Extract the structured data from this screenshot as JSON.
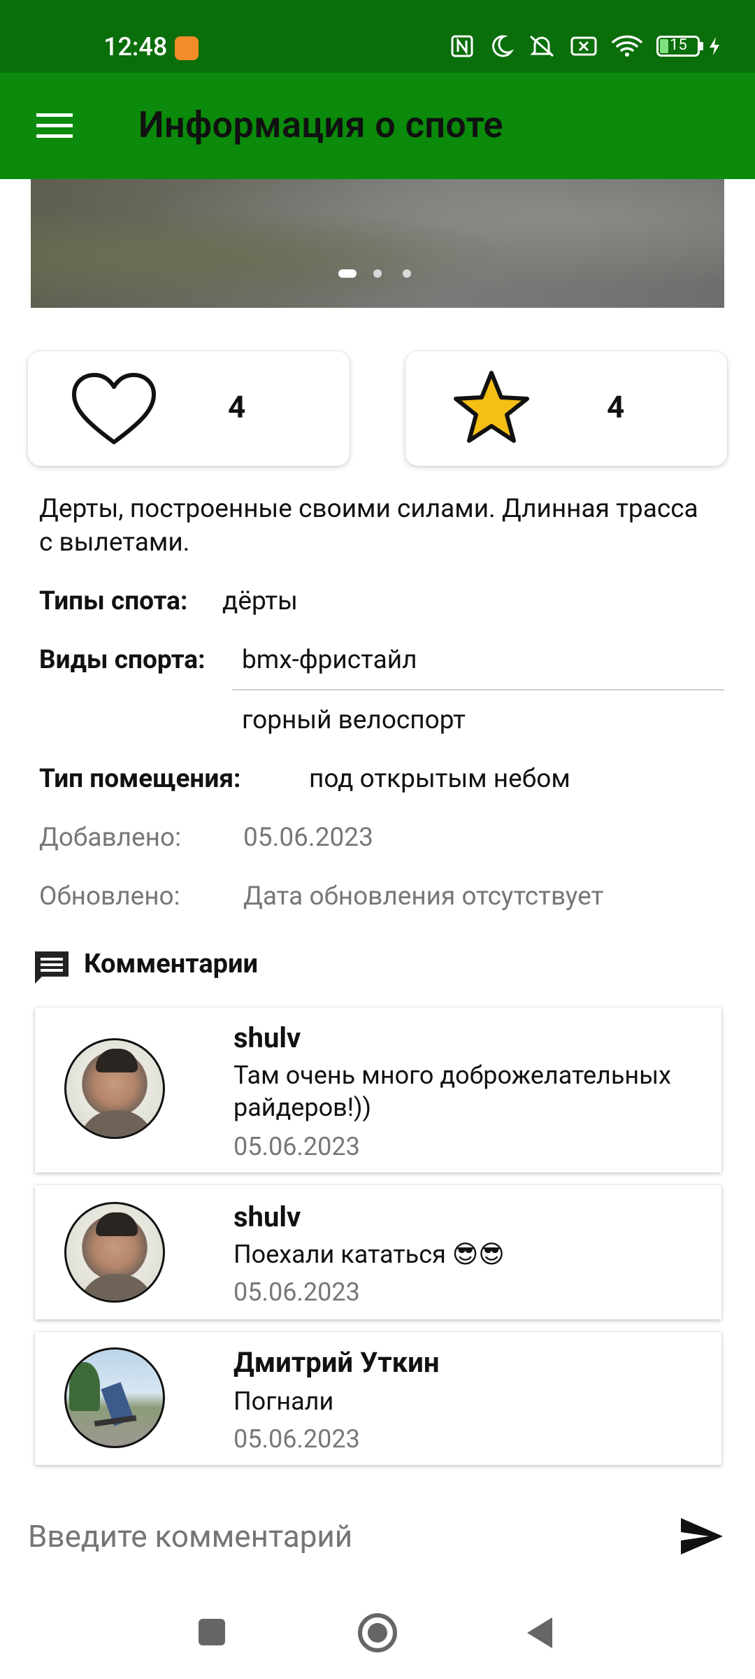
{
  "status_bar": {
    "time": "12:48",
    "battery": "15"
  },
  "app_bar": {
    "title": "Информация о споте"
  },
  "photo": {
    "pages": 3,
    "active_page": 1
  },
  "stats": {
    "likes": "4",
    "favorites": "4"
  },
  "description": "Дерты, построенные своими силами. Длинная трасса с вылетами.",
  "details": {
    "spot_types_label": "Типы спота:",
    "spot_types_value": "дёрты",
    "sports_label": "Виды спорта:",
    "sports": [
      "bmx-фристайл",
      "горный велоспорт"
    ],
    "venue_label": "Тип помещения:",
    "venue_value": "под открытым небом",
    "added_label": "Добавлено:",
    "added_value": "05.06.2023",
    "updated_label": "Обновлено:",
    "updated_value": "Дата обновления отсутствует"
  },
  "comments_header": "Комментарии",
  "comments": [
    {
      "author": "shulv",
      "text": "Там очень много доброжелательных райдеров!))",
      "date": "05.06.2023"
    },
    {
      "author": "shulv",
      "text": "Поехали кататься 😎😎",
      "date": "05.06.2023"
    },
    {
      "author": "Дмитрий Уткин",
      "text": "Погнали",
      "date": "05.06.2023"
    }
  ],
  "comment_input": {
    "placeholder": "Введите комментарий"
  },
  "colors": {
    "status_bar": "#0a6e0a",
    "app_bar": "#0b8a0b",
    "star": "#f5bf14"
  }
}
